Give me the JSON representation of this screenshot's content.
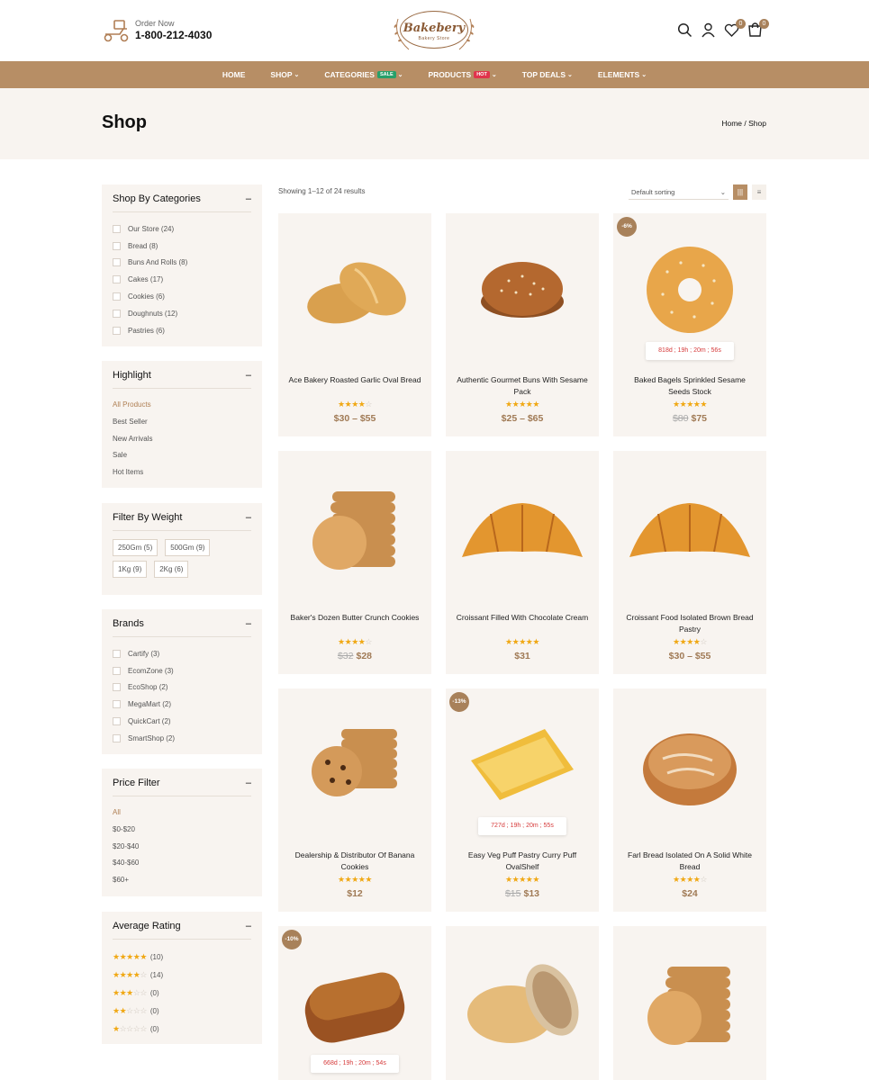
{
  "header": {
    "order_label": "Order Now",
    "phone": "1-800-212-4030",
    "logo_name": "Bakebery",
    "logo_sub": "Bakery Store",
    "wishlist_count": "0",
    "cart_count": "0",
    "icons": [
      "search-icon",
      "user-icon",
      "heart-icon",
      "cart-icon"
    ]
  },
  "nav": [
    {
      "label": "HOME",
      "chevron": false,
      "tag": ""
    },
    {
      "label": "SHOP",
      "chevron": true,
      "tag": ""
    },
    {
      "label": "CATEGORIES",
      "chevron": true,
      "tag": "SALE"
    },
    {
      "label": "PRODUCTS",
      "chevron": true,
      "tag": "HOT"
    },
    {
      "label": "TOP DEALS",
      "chevron": true,
      "tag": ""
    },
    {
      "label": "ELEMENTS",
      "chevron": true,
      "tag": ""
    }
  ],
  "hero": {
    "title": "Shop",
    "crumb_home": "Home",
    "crumb_sep": "/",
    "crumb_current": "Shop"
  },
  "sidebar": {
    "categories": {
      "title": "Shop By Categories",
      "items": [
        "Our Store (24)",
        "Bread (8)",
        "Buns And Rolls (8)",
        "Cakes (17)",
        "Cookies (6)",
        "Doughnuts (12)",
        "Pastries (6)"
      ]
    },
    "highlight": {
      "title": "Highlight",
      "items": [
        "All Products",
        "Best Seller",
        "New Arrivals",
        "Sale",
        "Hot Items"
      ]
    },
    "weight": {
      "title": "Filter By Weight",
      "items": [
        "250Gm (5)",
        "500Gm (9)",
        "1Kg (9)",
        "2Kg (6)"
      ]
    },
    "brands": {
      "title": "Brands",
      "items": [
        "Cartify (3)",
        "EcomZone (3)",
        "EcoShop (2)",
        "MegaMart (2)",
        "QuickCart (2)",
        "SmartShop (2)"
      ]
    },
    "price": {
      "title": "Price Filter",
      "items": [
        "All",
        "$0-$20",
        "$20-$40",
        "$40-$60",
        "$60+"
      ]
    },
    "rating": {
      "title": "Average Rating",
      "items": [
        {
          "stars": 5,
          "count": "(10)"
        },
        {
          "stars": 4,
          "count": "(14)"
        },
        {
          "stars": 3,
          "count": "(0)"
        },
        {
          "stars": 2,
          "count": "(0)"
        },
        {
          "stars": 1,
          "count": "(0)"
        }
      ]
    }
  },
  "toolbar": {
    "showing": "Showing 1–12 of 24 results",
    "sort": "Default sorting"
  },
  "products": [
    {
      "title": "Ace Bakery Roasted Garlic Oval Bread",
      "rating": 4,
      "old_price": "",
      "price": "$30 – $55",
      "discount": "",
      "timer": "",
      "icon": "bread-loaves"
    },
    {
      "title": "Authentic Gourmet Buns With Sesame Pack",
      "rating": 5,
      "old_price": "",
      "price": "$25 – $65",
      "discount": "",
      "timer": "",
      "icon": "sesame-bun"
    },
    {
      "title": "Baked Bagels Sprinkled Sesame Seeds Stock",
      "rating": 5,
      "old_price": "$80",
      "price": "$75",
      "discount": "-6%",
      "timer": "818d ; 19h ; 20m ; 56s",
      "icon": "bagel"
    },
    {
      "title": "Baker's Dozen Butter Crunch Cookies",
      "rating": 4,
      "old_price": "$32",
      "price": "$28",
      "discount": "",
      "timer": "",
      "icon": "cookie-stack"
    },
    {
      "title": "Croissant Filled With Chocolate Cream",
      "rating": 5,
      "old_price": "",
      "price": "$31",
      "discount": "",
      "timer": "",
      "icon": "croissant"
    },
    {
      "title": "Croissant Food Isolated Brown Bread Pastry",
      "rating": 4,
      "old_price": "",
      "price": "$30 – $55",
      "discount": "",
      "timer": "",
      "icon": "croissant"
    },
    {
      "title": "Dealership & Distributor Of Banana Cookies",
      "rating": 5,
      "old_price": "",
      "price": "$12",
      "discount": "",
      "timer": "",
      "icon": "choc-cookies"
    },
    {
      "title": "Easy Veg Puff Pastry Curry Puff OvalShelf",
      "rating": 5,
      "old_price": "$15",
      "price": "$13",
      "discount": "-13%",
      "timer": "727d ; 19h ; 20m ; 55s",
      "icon": "puff-pastry"
    },
    {
      "title": "Farl Bread Isolated On A Solid White Bread",
      "rating": 4,
      "old_price": "",
      "price": "$24",
      "discount": "",
      "timer": "",
      "icon": "round-bread"
    },
    {
      "title": "",
      "rating": 0,
      "old_price": "",
      "price": "",
      "discount": "-10%",
      "timer": "668d ; 19h ; 20m ; 54s",
      "icon": "seeded-loaf"
    },
    {
      "title": "",
      "rating": 0,
      "old_price": "",
      "price": "",
      "discount": "",
      "timer": "",
      "icon": "multigrain-bun"
    },
    {
      "title": "",
      "rating": 0,
      "old_price": "",
      "price": "",
      "discount": "",
      "timer": "",
      "icon": "cookie-stack"
    }
  ],
  "colors": {
    "accent": "#b78e65",
    "price": "#a07a55",
    "star": "#f0a814",
    "panel": "#f8f4f0",
    "timer": "#d63a3a"
  }
}
